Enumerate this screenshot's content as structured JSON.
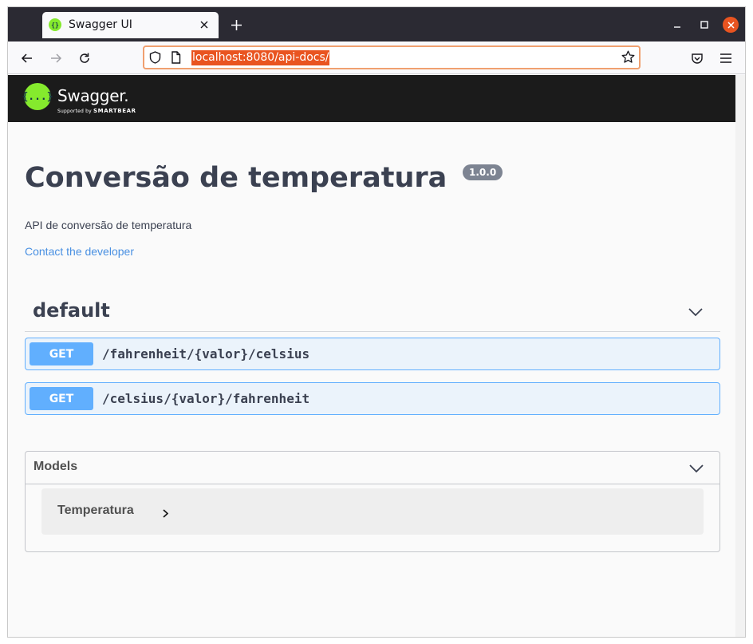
{
  "browser": {
    "tab_title": "Swagger UI",
    "url": "localhost:8080/api-docs/"
  },
  "icons": {
    "favicon": "swagger-favicon-icon",
    "tab_close": "close-icon",
    "new_tab": "plus-icon",
    "minimize": "minimize-icon",
    "maximize": "maximize-icon",
    "window_close": "close-icon",
    "back": "arrow-left-icon",
    "forward": "arrow-right-icon",
    "reload": "reload-icon",
    "shield": "shield-icon",
    "page": "page-icon",
    "bookmark": "star-icon",
    "pocket": "pocket-icon",
    "menu": "hamburger-icon"
  },
  "swagger": {
    "logo_glyph": "{...}",
    "logo_name": "Swagger.",
    "logo_sub_prefix": "Supported by",
    "logo_sub_brand": "SMARTBEAR"
  },
  "info": {
    "title": "Conversão de temperatura",
    "version": "1.0.0",
    "description": "API de conversão de temperatura",
    "contact": "Contact the developer"
  },
  "tag": {
    "name": "default",
    "operations": [
      {
        "method": "GET",
        "path": "/fahrenheit/{valor}/celsius"
      },
      {
        "method": "GET",
        "path": "/celsius/{valor}/fahrenheit"
      }
    ]
  },
  "models": {
    "title": "Models",
    "items": [
      {
        "name": "Temperatura"
      }
    ]
  },
  "colors": {
    "get_method": "#61affe",
    "get_background": "#ebf3fb",
    "swagger_green": "#85ea2d",
    "url_highlight": "#e95420",
    "title_text": "#3b4151",
    "link": "#4990e2"
  }
}
